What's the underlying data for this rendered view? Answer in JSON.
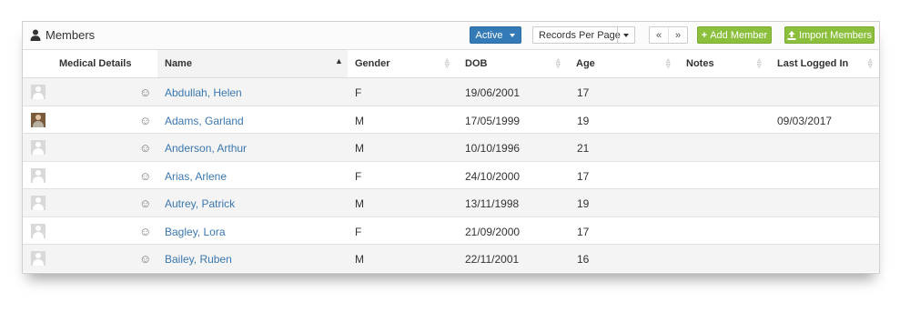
{
  "panel": {
    "title": "Members",
    "status_filter": "Active",
    "records_per_page_label": "Records Per Page",
    "pager_prev": "«",
    "pager_next": "»",
    "add_member_label": "Add Member",
    "import_members_label": "Import Members",
    "colors": {
      "primary": "#337ab7",
      "success": "#8bbf3c",
      "link": "#3a77b0"
    }
  },
  "table": {
    "columns": [
      "Medical Details",
      "Name",
      "Gender",
      "DOB",
      "Age",
      "Notes",
      "Last Logged In"
    ],
    "sorted_column": "Name",
    "sort_direction": "ascending",
    "rows": [
      {
        "avatar": "default-avatar",
        "medical": "smiley-icon",
        "name": "Abdullah, Helen",
        "gender": "F",
        "dob": "19/06/2001",
        "age": "17",
        "notes": "",
        "last_logged_in": ""
      },
      {
        "avatar": "photo-avatar",
        "medical": "smiley-icon",
        "name": "Adams, Garland",
        "gender": "M",
        "dob": "17/05/1999",
        "age": "19",
        "notes": "",
        "last_logged_in": "09/03/2017"
      },
      {
        "avatar": "default-avatar",
        "medical": "smiley-icon",
        "name": "Anderson, Arthur",
        "gender": "M",
        "dob": "10/10/1996",
        "age": "21",
        "notes": "",
        "last_logged_in": ""
      },
      {
        "avatar": "default-avatar",
        "medical": "smiley-icon",
        "name": "Arias, Arlene",
        "gender": "F",
        "dob": "24/10/2000",
        "age": "17",
        "notes": "",
        "last_logged_in": ""
      },
      {
        "avatar": "default-avatar",
        "medical": "smiley-icon",
        "name": "Autrey, Patrick",
        "gender": "M",
        "dob": "13/11/1998",
        "age": "19",
        "notes": "",
        "last_logged_in": ""
      },
      {
        "avatar": "default-avatar",
        "medical": "smiley-icon",
        "name": "Bagley, Lora",
        "gender": "F",
        "dob": "21/09/2000",
        "age": "17",
        "notes": "",
        "last_logged_in": ""
      },
      {
        "avatar": "default-avatar",
        "medical": "smiley-icon",
        "name": "Bailey, Ruben",
        "gender": "M",
        "dob": "22/11/2001",
        "age": "16",
        "notes": "",
        "last_logged_in": ""
      }
    ]
  }
}
